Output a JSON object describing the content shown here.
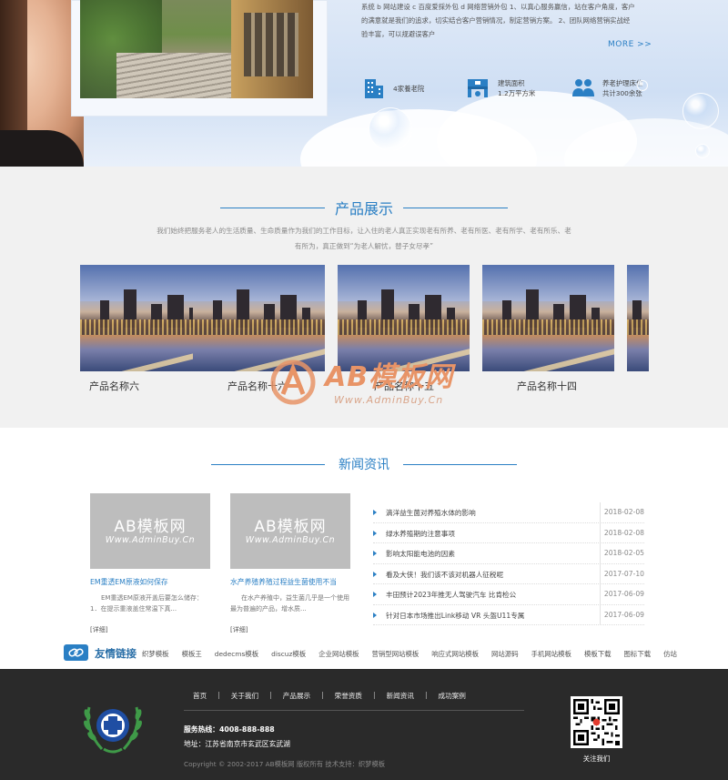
{
  "about": {
    "intro_lines": [
      "系统 b 网站建设 c 百度爱採外包 d 网络营销外包 1、以真心服务赢信，站在客户角度，客户",
      "的满意就是我们的追求，切实结合客户营销情况，制定营销方案。 2、团队网络营销实战经",
      "验丰富，可以规避误客户"
    ],
    "more_label": "MORE >>",
    "stats": [
      {
        "icon": "building-icon",
        "lines": [
          "4家養老院"
        ]
      },
      {
        "icon": "bed-icon",
        "lines": [
          "建筑面积",
          "1.2万平方米"
        ]
      },
      {
        "icon": "people-icon",
        "lines": [
          "养老护理床位",
          "共计300余张"
        ]
      }
    ]
  },
  "products": {
    "title": "产品展示",
    "description": "我们始终把服务老人的生活质量、生命质量作为我们的工作目标，让入住的老人真正实现老有所养、老有所医、老有所学、老有所乐、老有所为，真正做到“为老人解忧，替子女尽孝”",
    "items": [
      {
        "name": "产品名称六"
      },
      {
        "name": "产品名称十六"
      },
      {
        "name": "产品名称十五"
      },
      {
        "name": "产品名称十四"
      }
    ]
  },
  "watermark": {
    "main": "AB模板网",
    "sub": "Www.AdminBuy.Cn"
  },
  "news": {
    "title": "新闻资讯",
    "cards": [
      {
        "ph_main": "AB模板网",
        "ph_sub": "Www.AdminBuy.Cn",
        "title": "EM重透EM原液如何保存",
        "summary": "EM重透EM原液开盖后要怎么储存：1．在提示重液盖住常温下真...",
        "detail": "[详细]"
      },
      {
        "ph_main": "AB模板网",
        "ph_sub": "Www.AdminBuy.Cn",
        "title": "水产养殖养殖过程益生菌使用不当",
        "summary": "在水产养殖中，益生菌几乎是一个使用最为普遍的产品，增水质...",
        "detail": "[详细]"
      }
    ],
    "list": [
      {
        "title": "滴洋益生菌对养殖水体的影响",
        "date": "2018-02-08"
      },
      {
        "title": "绿水养殖期的注意事项",
        "date": "2018-02-08"
      },
      {
        "title": "影响太阳能电池的因素",
        "date": "2018-02-05"
      },
      {
        "title": "看及大侠！我们该不该对机器人征税呢",
        "date": "2017-07-10"
      },
      {
        "title": "丰田预计2023年推无人驾驶汽车 比肯检公",
        "date": "2017-06-09"
      },
      {
        "title": "针对日本市场推出Link移动 VR 头盔U11专属",
        "date": "2017-06-09"
      }
    ]
  },
  "friend_links": {
    "label": "友情链接",
    "items": [
      "织梦模板",
      "模板王",
      "dedecms模板",
      "discuz模板",
      "企业网站模板",
      "营销型网站模板",
      "响应式网站模板",
      "网站源码",
      "手机网站模板",
      "模板下载",
      "图标下载",
      "仿站"
    ]
  },
  "footer": {
    "nav": [
      "首页",
      "关于我们",
      "产品展示",
      "荣誉资质",
      "新闻资讯",
      "成功案例"
    ],
    "hotline": "服务热线：4008-888-888",
    "address": "地址：江苏省南京市玄武区玄武湖",
    "copyright": "Copyright © 2002-2017 AB模板网 版权所有 技术支持：织梦模板",
    "qr_label": "关注我们"
  },
  "colors": {
    "accent": "#2a7fc4",
    "footer_bg": "#2a2a2a",
    "products_bg": "#f1f1f1",
    "watermark": "#e89467"
  }
}
